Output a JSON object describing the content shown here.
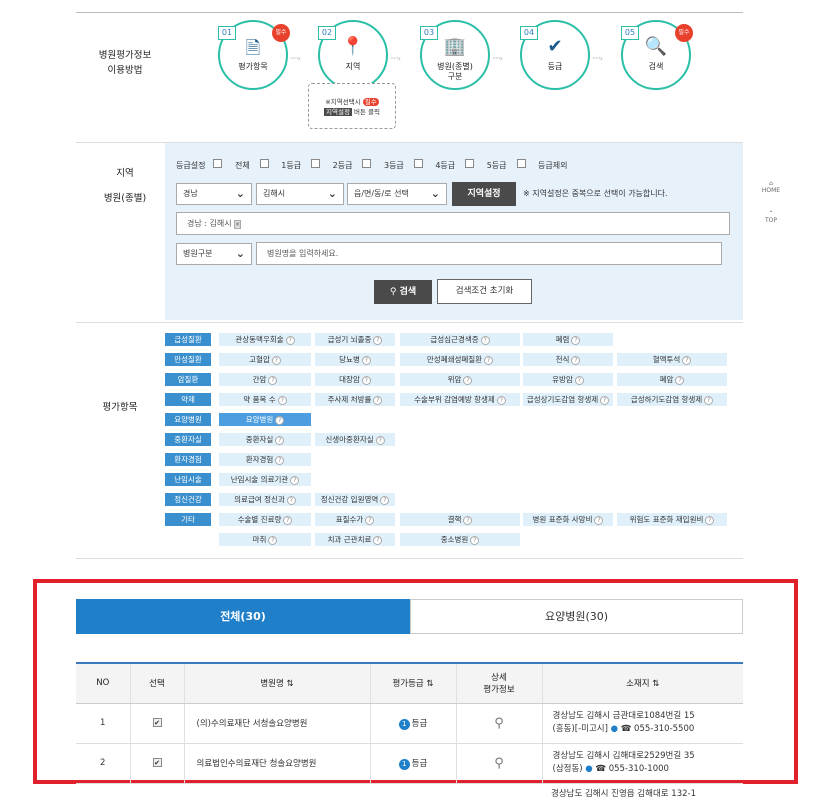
{
  "guide": {
    "label": "병원평가정보\n이용방법",
    "steps": [
      {
        "num": "01",
        "label": "평가항목",
        "badge": "필수",
        "icon": "document-icon"
      },
      {
        "num": "02",
        "label": "지역",
        "badge": "",
        "icon": "location-pin-icon"
      },
      {
        "num": "03",
        "label": "병원(종별)\n구분",
        "badge": "",
        "icon": "hospital-building-icon"
      },
      {
        "num": "04",
        "label": "등급",
        "badge": "",
        "icon": "checkmark-icon"
      },
      {
        "num": "05",
        "label": "검색",
        "badge": "필수",
        "icon": "search-icon"
      }
    ],
    "region_note_1": "※지역선택시",
    "region_note_badge": "필수",
    "region_note_btn": "지역설정",
    "region_note_2": "버튼 클릭"
  },
  "filter": {
    "label_region": "지역",
    "label_hospital": "병원(종별)",
    "grade_label": "등급설정",
    "grades": [
      "전체",
      "1등급",
      "2등급",
      "3등급",
      "4등급",
      "5등급",
      "등급제외"
    ],
    "sido": "경남",
    "sigungu": "김해시",
    "dong": "읍/면/동/로 선택",
    "region_btn": "지역설정",
    "region_hint": "※ 지역설정은 중복으로 선택이 가능합니다.",
    "selected_region": "경남 : 김해시",
    "hospital_type": "병원구분",
    "name_placeholder": "병원명을 입력하세요.",
    "search_btn": "검색",
    "reset_btn": "검색조건 초기화"
  },
  "eval": {
    "label": "평가항목",
    "rows": [
      {
        "cat": "급성질환",
        "items": [
          "관상동맥우회술",
          "급성기 뇌졸중",
          "급성심근경색증",
          "폐렴"
        ]
      },
      {
        "cat": "만성질환",
        "items": [
          "고혈압",
          "당뇨병",
          "만성폐쇄성폐질환",
          "천식",
          "혈액투석"
        ]
      },
      {
        "cat": "암질환",
        "items": [
          "간암",
          "대장암",
          "위암",
          "유방암",
          "폐암"
        ]
      },
      {
        "cat": "약제",
        "items": [
          "약 품목 수",
          "주사제 처방률",
          "수술부위 감염예방 항생제",
          "급성상기도감염 항생제",
          "급성하기도감염 항생제"
        ]
      },
      {
        "cat": "요양병원",
        "items": [
          "요양병원"
        ]
      },
      {
        "cat": "중환자실",
        "items": [
          "중환자실",
          "신생아중환자실"
        ]
      },
      {
        "cat": "환자경험",
        "items": [
          "환자경험"
        ]
      },
      {
        "cat": "난임시술",
        "items": [
          "난임시술 의료기관"
        ]
      },
      {
        "cat": "정신건강",
        "items": [
          "의료급여 정신과",
          "정신건강 입원영역"
        ]
      },
      {
        "cat": "기타",
        "items": [
          "수술별 진료량",
          "표질수가",
          "결핵",
          "병원 표준화 사망비",
          "위험도 표준화 재입원비"
        ]
      },
      {
        "cat": "",
        "items": [
          "마취",
          "치과 근관치료",
          "중소병원"
        ]
      }
    ]
  },
  "tabs": {
    "all": "전체(30)",
    "care": "요양병원(30)"
  },
  "table": {
    "headers": [
      "NO",
      "선택",
      "병원명",
      "평가등급",
      "상세\n평가정보",
      "소재지"
    ],
    "rows": [
      {
        "no": "1",
        "name": "(의)수의료재단 서청솔요양병원",
        "grade": "1",
        "grade_suffix": "등급",
        "addr": "경상남도 김해시 금관대로1084번길 15\n(흥동)[-미고시]",
        "phone": "055-310-5500"
      },
      {
        "no": "2",
        "name": "의료법인수의료재단 청솔요양병원",
        "grade": "1",
        "grade_suffix": "등급",
        "addr": "경상남도 김해시 김해대로2529번길 35\n(삼정동)",
        "phone": "055-310-1000"
      }
    ],
    "partial_addr": "경상남도 김해시 진영읍 김해대로 132-1"
  },
  "side": {
    "home": "HOME",
    "top": "TOP"
  }
}
